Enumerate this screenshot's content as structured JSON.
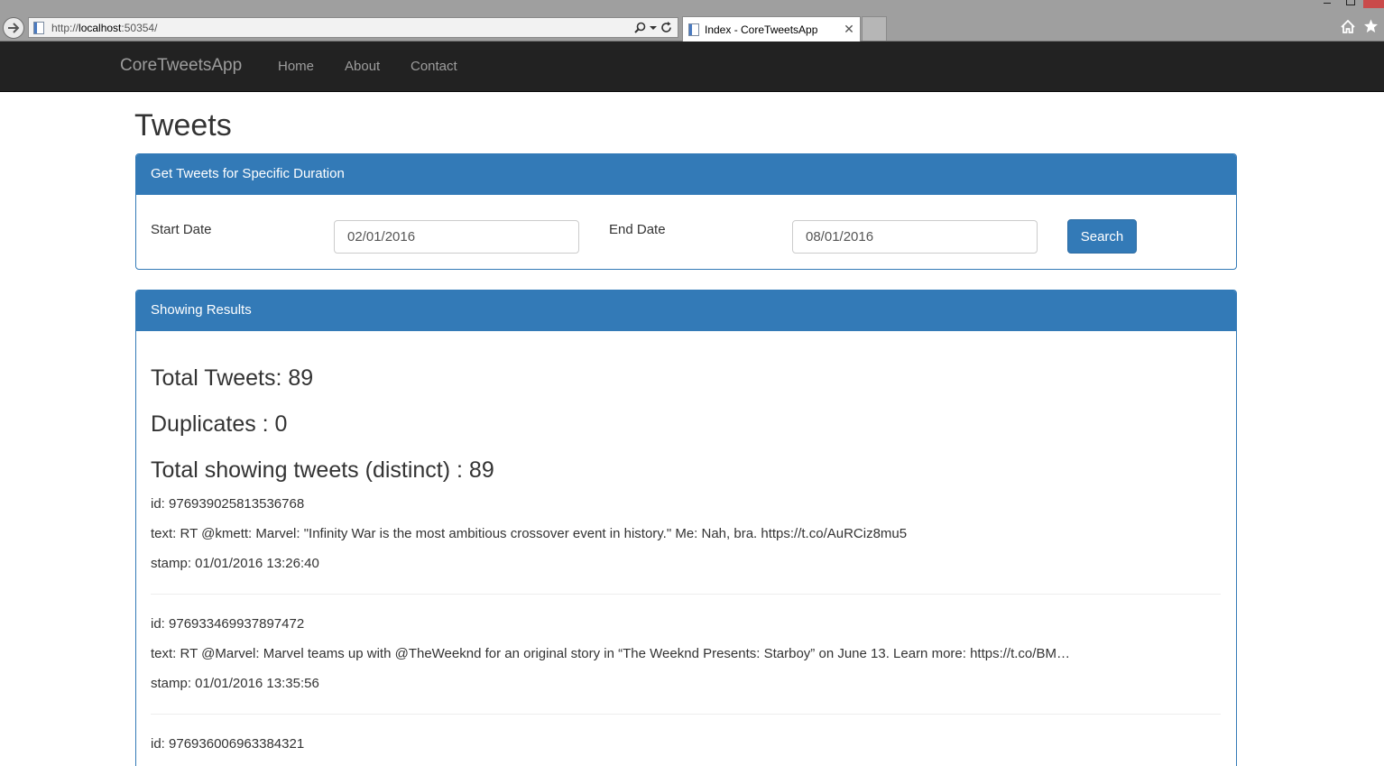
{
  "browser": {
    "url_prefix": "http://",
    "url_host": "localhost",
    "url_rest": ":50354/",
    "tab_title": "Index - CoreTweetsApp",
    "icons": [
      "back-icon",
      "page-icon",
      "search-icon",
      "dropdown-icon",
      "refresh-icon",
      "close-icon",
      "home-icon",
      "star-icon"
    ]
  },
  "navbar": {
    "brand": "CoreTweetsApp",
    "links": [
      "Home",
      "About",
      "Contact"
    ]
  },
  "page": {
    "title": "Tweets"
  },
  "search_panel": {
    "heading": "Get Tweets for Specific Duration",
    "start_label": "Start Date",
    "start_value": "02/01/2016",
    "end_label": "End Date",
    "end_value": "08/01/2016",
    "button": "Search"
  },
  "results_panel": {
    "heading": "Showing Results",
    "total": "Total Tweets: 89",
    "duplicates": "Duplicates : 0",
    "distinct": "Total showing tweets (distinct) : 89",
    "tweets": [
      {
        "id": "id: 976939025813536768",
        "text": "text: RT @kmett: Marvel: \"Infinity War is the most ambitious crossover event in history.\" Me: Nah, bra. https://t.co/AuRCiz8mu5",
        "stamp": "stamp: 01/01/2016 13:26:40"
      },
      {
        "id": "id: 976933469937897472",
        "text": "text: RT @Marvel: Marvel teams up with @TheWeeknd for an original story in “The Weeknd Presents: Starboy” on June 13. Learn more: https://t.co/BM…",
        "stamp": "stamp: 01/01/2016 13:35:56"
      },
      {
        "id": "id: 976936006963384321"
      }
    ]
  }
}
